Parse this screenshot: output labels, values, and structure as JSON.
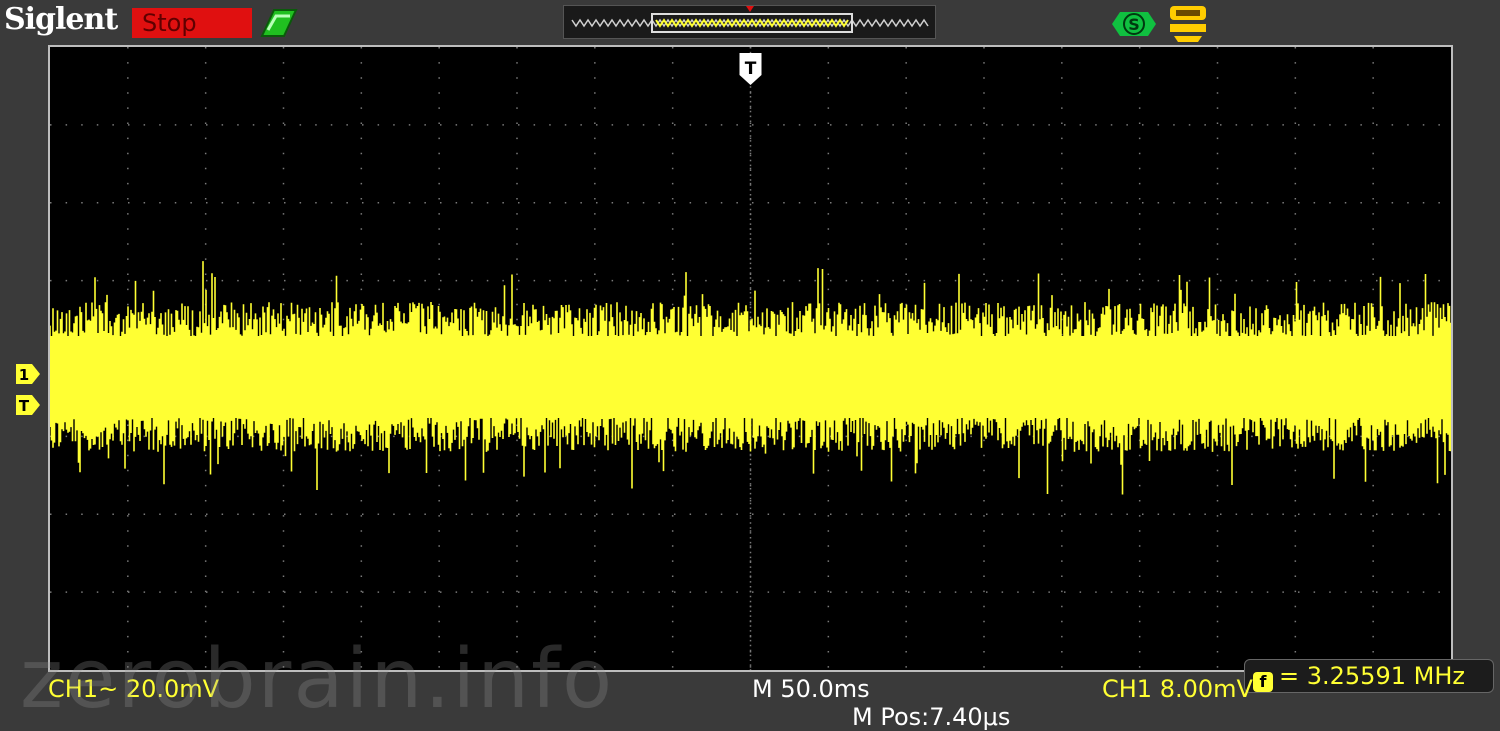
{
  "header": {
    "brand": "Siglent",
    "status": "Stop",
    "status_icon": "run-indicator-icon",
    "icons": [
      "s-mode-icon",
      "trigger-mode-icon"
    ]
  },
  "colors": {
    "trace": "#ffff33",
    "status_bg": "#e01010",
    "grid": "#7a7a7a",
    "screen_bg": "#000000",
    "frame": "#bdbdbd"
  },
  "screen": {
    "trigger_marker_top": "T",
    "ch1_marker": "1",
    "trigger_marker_left": "T"
  },
  "measurement": {
    "frequency": "= 3.25591 MHz"
  },
  "footer": {
    "ch1_scale": "CH1~ 20.0mV",
    "timebase": "M 50.0ms",
    "position": "M Pos:7.40μs",
    "trigger_level": "CH1 ⁡8.00mV"
  },
  "watermark": "zerobrain.info"
}
